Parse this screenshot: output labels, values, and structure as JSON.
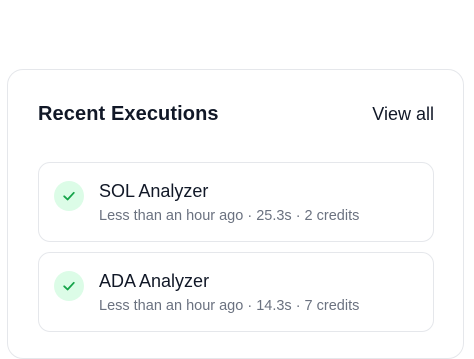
{
  "recent_executions": {
    "title": "Recent Executions",
    "view_all_label": "View all",
    "items": [
      {
        "name": "SOL Analyzer",
        "meta": "Less than an hour ago · 25.3s · 2 credits",
        "status_icon": "check-icon",
        "status_color": "#16a34a"
      },
      {
        "name": "ADA Analyzer",
        "meta": "Less than an hour ago · 14.3s · 7 credits",
        "status_icon": "check-icon",
        "status_color": "#16a34a"
      }
    ]
  }
}
